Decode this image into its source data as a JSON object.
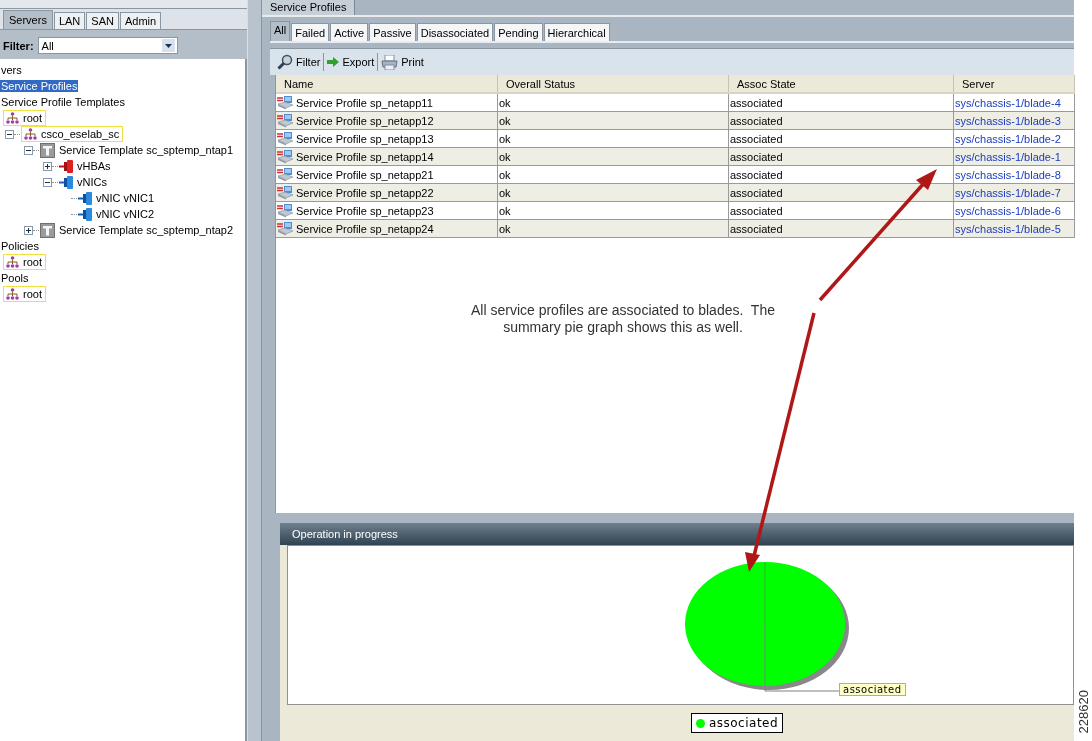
{
  "left_tabs": [
    {
      "label": "Servers",
      "selected": true
    },
    {
      "label": "LAN",
      "selected": false
    },
    {
      "label": "SAN",
      "selected": false
    },
    {
      "label": "Admin",
      "selected": false
    }
  ],
  "filter": {
    "label": "Filter:",
    "value": "All"
  },
  "tree": [
    {
      "label": "vers",
      "selected": false
    },
    {
      "label": "Service Profiles",
      "selected": true
    },
    {
      "label": "Service Profile Templates",
      "selected": false,
      "children": [
        {
          "label": "root",
          "kind": "org",
          "selected": false,
          "children": [
            {
              "label": "csco_eselab_sc",
              "kind": "org",
              "selected": false,
              "expanded": true,
              "children": [
                {
                  "label": "Service Template sc_sptemp_ntap1",
                  "kind": "template",
                  "selected": false,
                  "expanded": true,
                  "children": [
                    {
                      "label": "vHBAs",
                      "kind": "vhba",
                      "selected": false,
                      "expanded": false
                    },
                    {
                      "label": "vNICs",
                      "kind": "vnic",
                      "selected": false,
                      "expanded": true,
                      "children": [
                        {
                          "label": "vNIC vNIC1",
                          "kind": "vnic",
                          "selected": false
                        },
                        {
                          "label": "vNIC vNIC2",
                          "kind": "vnic",
                          "selected": false
                        }
                      ]
                    }
                  ]
                },
                {
                  "label": "Service Template sc_sptemp_ntap2",
                  "kind": "template",
                  "selected": false,
                  "expanded": false
                }
              ]
            }
          ]
        }
      ]
    },
    {
      "label": "Policies",
      "selected": false,
      "children": [
        {
          "label": "root",
          "kind": "org",
          "selected": false
        }
      ]
    },
    {
      "label": "Pools",
      "selected": false,
      "children": [
        {
          "label": "root",
          "kind": "org",
          "selected": false
        }
      ]
    }
  ],
  "panel_title": "Service Profiles",
  "tabs": [
    {
      "label": "All",
      "selected": true
    },
    {
      "label": "Failed",
      "selected": false
    },
    {
      "label": "Active",
      "selected": false
    },
    {
      "label": "Passive",
      "selected": false
    },
    {
      "label": "Disassociated",
      "selected": false
    },
    {
      "label": "Pending",
      "selected": false
    },
    {
      "label": "Hierarchical",
      "selected": false
    }
  ],
  "toolbar": [
    {
      "label": "Filter",
      "kind": "filter"
    },
    {
      "label": "Export",
      "kind": "export"
    },
    {
      "label": "Print",
      "kind": "print"
    }
  ],
  "table": {
    "columns": [
      "Name",
      "Overall Status",
      "Assoc State",
      "Server"
    ],
    "rows": [
      {
        "name": "Service Profile sp_netapp11",
        "overall_status": "ok",
        "assoc_state": "associated",
        "server": "sys/chassis-1/blade-4"
      },
      {
        "name": "Service Profile sp_netapp12",
        "overall_status": "ok",
        "assoc_state": "associated",
        "server": "sys/chassis-1/blade-3"
      },
      {
        "name": "Service Profile sp_netapp13",
        "overall_status": "ok",
        "assoc_state": "associated",
        "server": "sys/chassis-1/blade-2"
      },
      {
        "name": "Service Profile sp_netapp14",
        "overall_status": "ok",
        "assoc_state": "associated",
        "server": "sys/chassis-1/blade-1"
      },
      {
        "name": "Service Profile sp_netapp21",
        "overall_status": "ok",
        "assoc_state": "associated",
        "server": "sys/chassis-1/blade-8"
      },
      {
        "name": "Service Profile sp_netapp22",
        "overall_status": "ok",
        "assoc_state": "associated",
        "server": "sys/chassis-1/blade-7"
      },
      {
        "name": "Service Profile sp_netapp23",
        "overall_status": "ok",
        "assoc_state": "associated",
        "server": "sys/chassis-1/blade-6"
      },
      {
        "name": "Service Profile sp_netapp24",
        "overall_status": "ok",
        "assoc_state": "associated",
        "server": "sys/chassis-1/blade-5"
      }
    ]
  },
  "annotation": [
    "All service profiles are associated to blades.  The",
    "summary pie graph shows this as well."
  ],
  "chart_panel": {
    "title": "Operation in progress",
    "slice_label": "associated",
    "legend": [
      {
        "label": "associated",
        "color": "#00ff00"
      }
    ]
  },
  "figure_id": "228620"
}
